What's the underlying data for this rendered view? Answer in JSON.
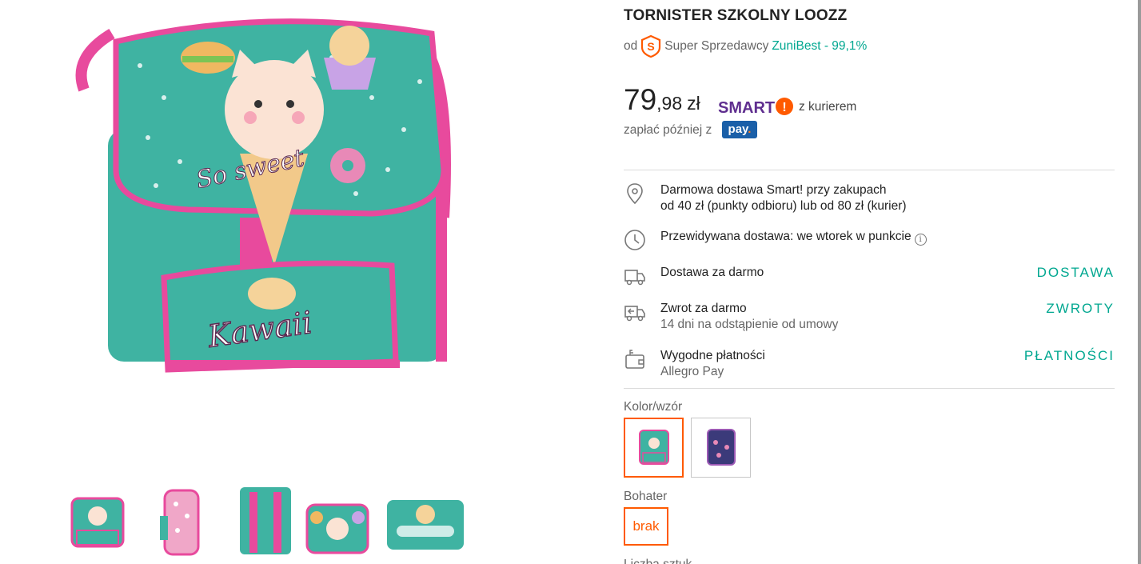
{
  "product": {
    "title": "TORNISTER SZKOLNY LOOZZ",
    "seller_prefix": "od",
    "seller_badge_letter": "S",
    "seller_type": "Super Sprzedawcy",
    "seller_name": "ZuniBest - 99,1%"
  },
  "price": {
    "integer": "79",
    "decimals": ",98",
    "currency": "zł",
    "smart_label": "SMART",
    "smart_mark": "!",
    "courier_text": "z kurierem",
    "pay_later_text": "zapłać później z",
    "pay_badge": "pay",
    "pay_badge_dot": "."
  },
  "features": [
    {
      "icon": "location-pin-icon",
      "line1": "Darmowa dostawa Smart! przy zakupach",
      "line2": "od 40 zł (punkty odbioru) lub od 80 zł (kurier)",
      "link": ""
    },
    {
      "icon": "clock-icon",
      "line1": "Przewidywana dostawa: we wtorek w punkcie",
      "line2": "",
      "link": ""
    },
    {
      "icon": "truck-icon",
      "line1": "Dostawa za darmo",
      "line2": "",
      "link": "DOSTAWA"
    },
    {
      "icon": "return-truck-icon",
      "line1": "Zwrot za darmo",
      "line2": "14 dni na odstąpienie od umowy",
      "link": "ZWROTY"
    },
    {
      "icon": "wallet-icon",
      "line1": "Wygodne płatności",
      "line2": "Allegro Pay",
      "link": "PŁATNOŚCI"
    }
  ],
  "info_glyph": "i",
  "variants": {
    "color_label": "Kolor/wzór",
    "hero_label": "Bohater",
    "hero_option": "brak",
    "quantity_label": "Liczba sztuk"
  },
  "colors": {
    "accent": "#00a790",
    "orange": "#ff5a00",
    "smart_purple": "#5f2e8f",
    "teal_bag": "#3fb3a2",
    "pink_trim": "#e84a9d"
  }
}
